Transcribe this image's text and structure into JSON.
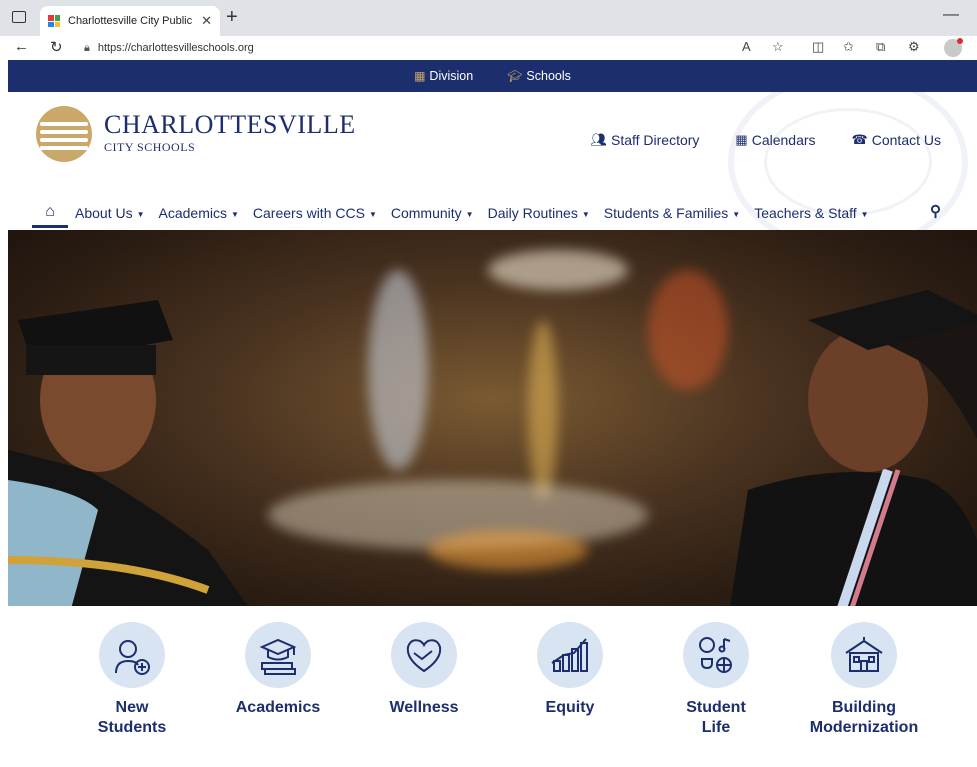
{
  "browser": {
    "tab_title": "Charlottesville City Public Schools",
    "url": "https://charlottesvilleschools.org"
  },
  "utility_bar": {
    "items": [
      {
        "label": "Division",
        "icon": "building-icon"
      },
      {
        "label": "Schools",
        "icon": "graduation-cap-icon"
      }
    ]
  },
  "header": {
    "brand_title": "Charlottesville",
    "brand_subtitle": "City Schools",
    "quick_links": [
      {
        "label": "Staff Directory",
        "icon": "users-icon"
      },
      {
        "label": "Calendars",
        "icon": "calendar-icon"
      },
      {
        "label": "Contact Us",
        "icon": "contact-icon"
      }
    ]
  },
  "nav": {
    "items": [
      {
        "label": "About Us"
      },
      {
        "label": "Academics"
      },
      {
        "label": "Careers with CCS"
      },
      {
        "label": "Community"
      },
      {
        "label": "Daily Routines"
      },
      {
        "label": "Students & Families"
      },
      {
        "label": "Teachers & Staff"
      }
    ]
  },
  "quick_nav": {
    "items": [
      {
        "line1": "New",
        "line2": "Students",
        "icon": "new-student-icon"
      },
      {
        "line1": "Academics",
        "line2": "",
        "icon": "academics-icon"
      },
      {
        "line1": "Wellness",
        "line2": "",
        "icon": "wellness-icon"
      },
      {
        "line1": "Equity",
        "line2": "",
        "icon": "equity-icon"
      },
      {
        "line1": "Student",
        "line2": "Life",
        "icon": "student-life-icon"
      },
      {
        "line1": "Building",
        "line2": "Modernization",
        "icon": "building-modernization-icon"
      }
    ]
  },
  "colors": {
    "navy": "#1c2e6e",
    "gold": "#c9a86a",
    "icon_bg": "#d9e4f2"
  }
}
